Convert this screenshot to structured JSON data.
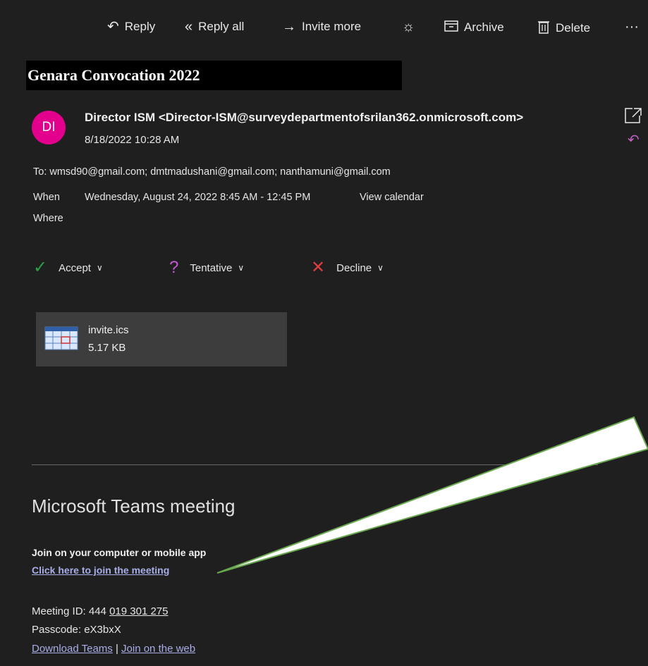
{
  "toolbar": {
    "reply_label": "Reply",
    "reply_all_label": "Reply all",
    "invite_more_label": "Invite more",
    "archive_label": "Archive",
    "delete_label": "Delete",
    "more_label": "···"
  },
  "message": {
    "subject": "Genara Convocation 2022",
    "avatar_initials": "DI",
    "avatar_color": "#e3008c",
    "sender": "Director ISM <Director-ISM@surveydepartmentofsrilan362.onmicrosoft.com>",
    "sent_date": "8/18/2022 10:28 AM",
    "to": "To: wmsd90@gmail.com; dmtmadushani@gmail.com; nanthamuni@gmail.com",
    "when_label": "When",
    "when_value": "Wednesday, August 24, 2022 8:45 AM - 12:45 PM",
    "view_calendar": "View calendar",
    "where_label": "Where"
  },
  "response": {
    "accept": "Accept",
    "tentative": "Tentative",
    "decline": "Decline",
    "accept_color": "#2ea043",
    "tentative_color": "#c35ad1",
    "decline_color": "#e03d3d"
  },
  "attachment": {
    "name": "invite.ics",
    "size": "5.17 KB"
  },
  "teams": {
    "title": "Microsoft Teams meeting",
    "join_label": "Join on your computer or mobile app",
    "join_link": "Click here to join the meeting",
    "meeting_id_label": "Meeting ID: 444 ",
    "meeting_id_value": "019 301 275",
    "passcode": "Passcode: eX3bxX",
    "download_teams": "Download Teams",
    "separator": " | ",
    "join_web": "Join on the web",
    "link_color": "#a7aee8"
  },
  "icons": [
    "reply-icon",
    "reply-all-icon",
    "forward-arrow-icon",
    "sun-icon",
    "archive-icon",
    "trash-icon",
    "more-icon",
    "popout-icon",
    "check-icon",
    "question-icon",
    "x-icon",
    "chevron-down-icon",
    "calendar-file-icon"
  ]
}
